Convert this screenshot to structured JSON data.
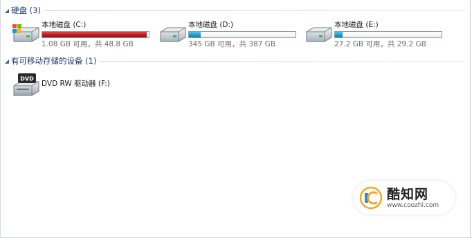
{
  "groups": {
    "hard_disks": {
      "title": "硬盘 (3)"
    },
    "removable": {
      "title": "有可移动存储的设备 (1)"
    }
  },
  "drives": [
    {
      "name": "本地磁盘 (C:)",
      "space": "1.08 GB 可用，共 48.8 GB",
      "used_fraction": 0.978,
      "bar_color": "#c8141c"
    },
    {
      "name": "本地磁盘 (D:)",
      "space": "345 GB 可用，共 387 GB",
      "used_fraction": 0.11,
      "bar_color": "#1e9fcf"
    },
    {
      "name": "本地磁盘 (E:)",
      "space": "27.2 GB 可用，共 29.2 GB",
      "used_fraction": 0.07,
      "bar_color": "#1e9fcf"
    }
  ],
  "removable_devices": [
    {
      "name": "DVD RW 驱动器 (F:)",
      "icon_label": "DVD"
    }
  ],
  "watermark": {
    "brand": "酷知网",
    "url": "www.coozhi.com"
  }
}
